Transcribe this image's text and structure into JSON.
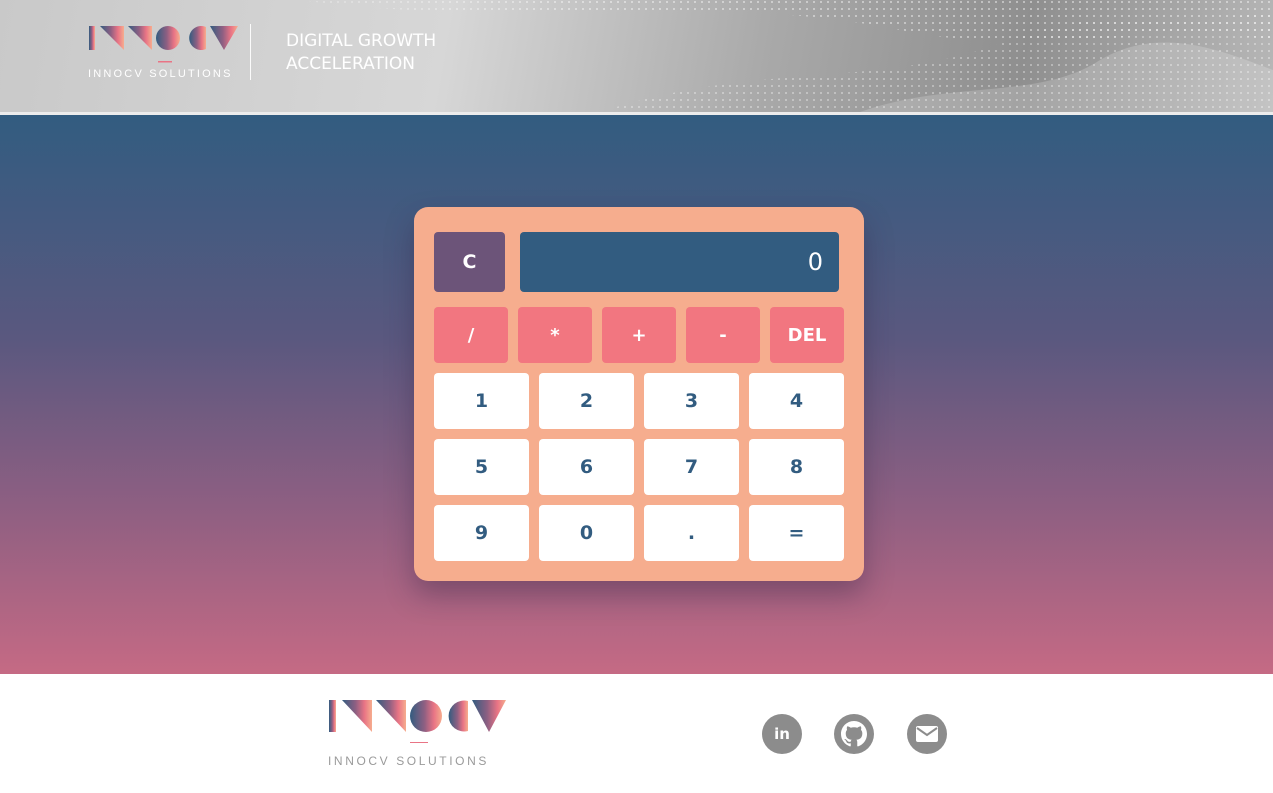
{
  "header": {
    "brand_sub": "INNOCV SOLUTIONS",
    "tagline_line1": "DIGITAL GROWTH",
    "tagline_line2": "ACCELERATION"
  },
  "calculator": {
    "clear_label": "C",
    "display_value": "0",
    "operators": [
      "/",
      "*",
      "+",
      "-",
      "DEL"
    ],
    "keys_row1": [
      "1",
      "2",
      "3",
      "4"
    ],
    "keys_row2": [
      "5",
      "6",
      "7",
      "8"
    ],
    "keys_row3": [
      "9",
      "0",
      ".",
      "="
    ]
  },
  "footer": {
    "brand_sub": "INNOCV SOLUTIONS",
    "social": [
      {
        "icon": "linkedin-icon",
        "label": "in"
      },
      {
        "icon": "github-icon"
      },
      {
        "icon": "mail-icon"
      }
    ]
  },
  "colors": {
    "calc_body": "#f6ad8e",
    "display_bg": "#325c80",
    "clear_bg": "#6c5479",
    "operator_bg": "#f27680",
    "digit_text": "#325c80",
    "social_bg": "#8c8c8c"
  }
}
